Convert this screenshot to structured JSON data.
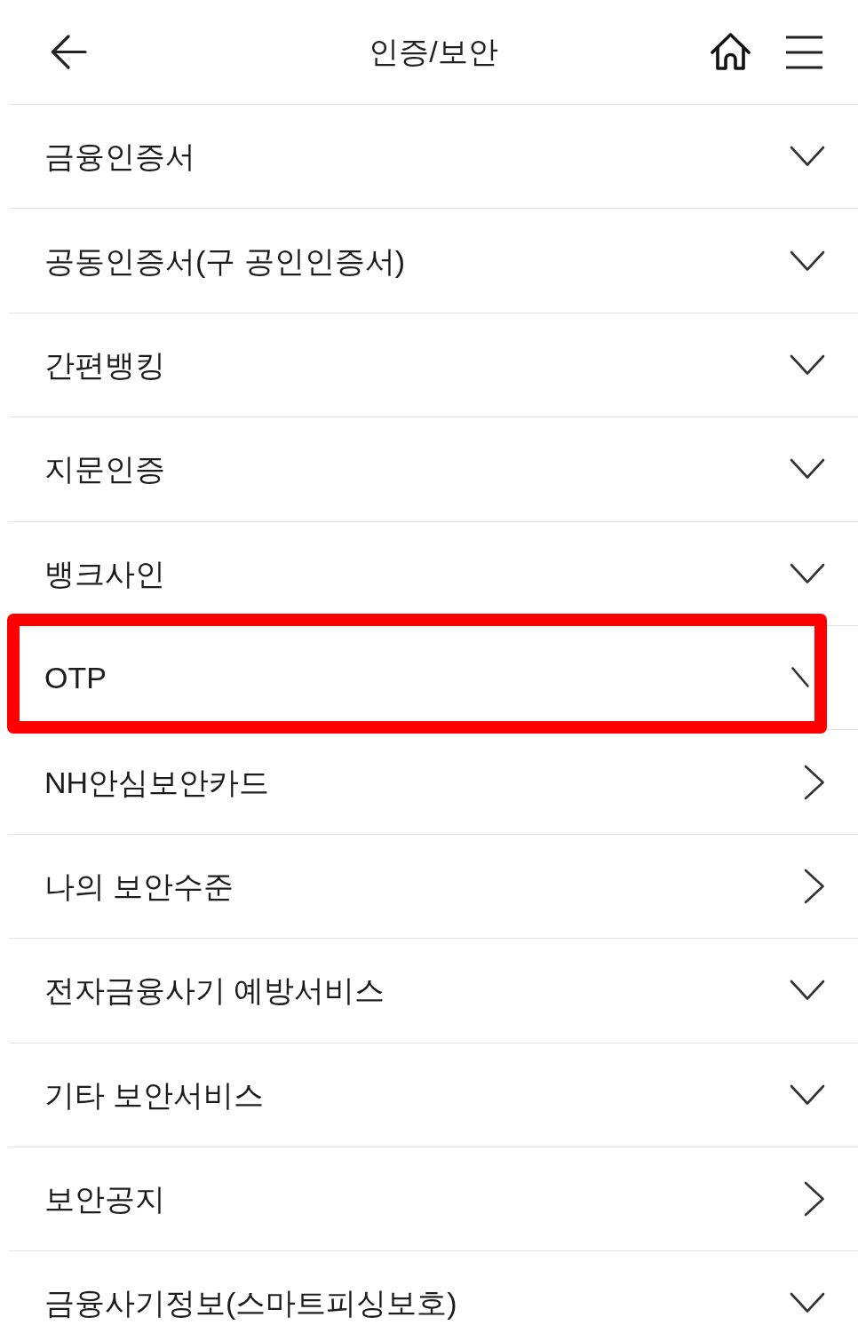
{
  "header": {
    "title": "인증/보안"
  },
  "items": [
    {
      "label": "금융인증서",
      "kind": "down",
      "highlighted": false
    },
    {
      "label": "공동인증서(구 공인인증서)",
      "kind": "down",
      "highlighted": false
    },
    {
      "label": "간편뱅킹",
      "kind": "down",
      "highlighted": false
    },
    {
      "label": "지문인증",
      "kind": "down",
      "highlighted": false
    },
    {
      "label": "뱅크사인",
      "kind": "down",
      "highlighted": false
    },
    {
      "label": "OTP",
      "kind": "partial",
      "highlighted": true
    },
    {
      "label": "NH안심보안카드",
      "kind": "right",
      "highlighted": false
    },
    {
      "label": "나의 보안수준",
      "kind": "right",
      "highlighted": false
    },
    {
      "label": "전자금융사기 예방서비스",
      "kind": "down",
      "highlighted": false
    },
    {
      "label": "기타 보안서비스",
      "kind": "down",
      "highlighted": false
    },
    {
      "label": "보안공지",
      "kind": "right",
      "highlighted": false
    },
    {
      "label": "금융사기정보(스마트피싱보호)",
      "kind": "down",
      "highlighted": false
    }
  ]
}
